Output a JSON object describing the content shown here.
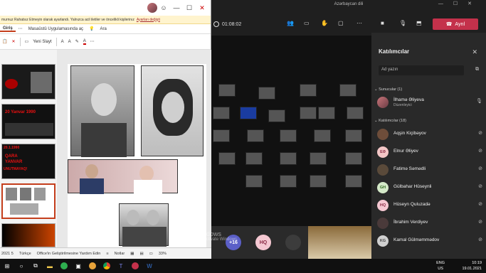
{
  "ppt": {
    "banner_text": "murnuz Rahatsız Etmeyin olarak ayarlandı. Yalnızca acil iletiler ve öncelikli kişilerinız",
    "banner_link": "Ayarları değişti",
    "tabs": [
      "Giriş",
      "Masaüstü Uygulamasında aç",
      "Ara"
    ],
    "new_slide": "Yeni Slayt",
    "thumb_caption_1": "20 Yanvar 1990",
    "thumb_caption_2a": "20.1.1990",
    "thumb_caption_2b": "QARA",
    "thumb_caption_2c": "YANVAR",
    "thumb_caption_2d": "UNUTMAYAQ!",
    "status_slide": "2021 5",
    "status_lang": "Türkçe",
    "status_help": "Office'in Geliştirilmesine Yardım Edin",
    "status_notes": "Notlar",
    "zoom": "33%"
  },
  "teams": {
    "window_title": "Azərbaycan dili",
    "timer": "01:08:02",
    "leave_label": "Ayrıl",
    "more_count": "+16",
    "hq_initials": "HQ",
    "panel": {
      "title": "Katılımcılar",
      "search_placeholder": "Ad yazın",
      "presenters_header": "Sunucular (1)",
      "attendees_header": "Katılımcılar (18)",
      "presenter": {
        "name": "İlhamə Əliyeva",
        "role": "Düzenleyici"
      },
      "attendees": [
        {
          "initials": "AK",
          "name": "Aqşin Kiçibəyov"
        },
        {
          "initials": "EƏ",
          "name": "Elnur Əliyev"
        },
        {
          "initials": "FS",
          "name": "Fatimə Səmədli"
        },
        {
          "initials": "GH",
          "name": "Gülbahar Hüseynli"
        },
        {
          "initials": "HQ",
          "name": "Hüseyn Quluzadə"
        },
        {
          "initials": "İV",
          "name": "İbrahim Verdiyev"
        },
        {
          "initials": "KG",
          "name": "Kamal Gülməmmədov"
        }
      ]
    }
  },
  "watermark": {
    "line1": "Activate Windows",
    "line2": "Go to Settings to activate Windows."
  },
  "taskbar": {
    "lang_top": "ENG",
    "lang_bottom": "US",
    "time": "10:19",
    "date": "19.01.2021"
  }
}
